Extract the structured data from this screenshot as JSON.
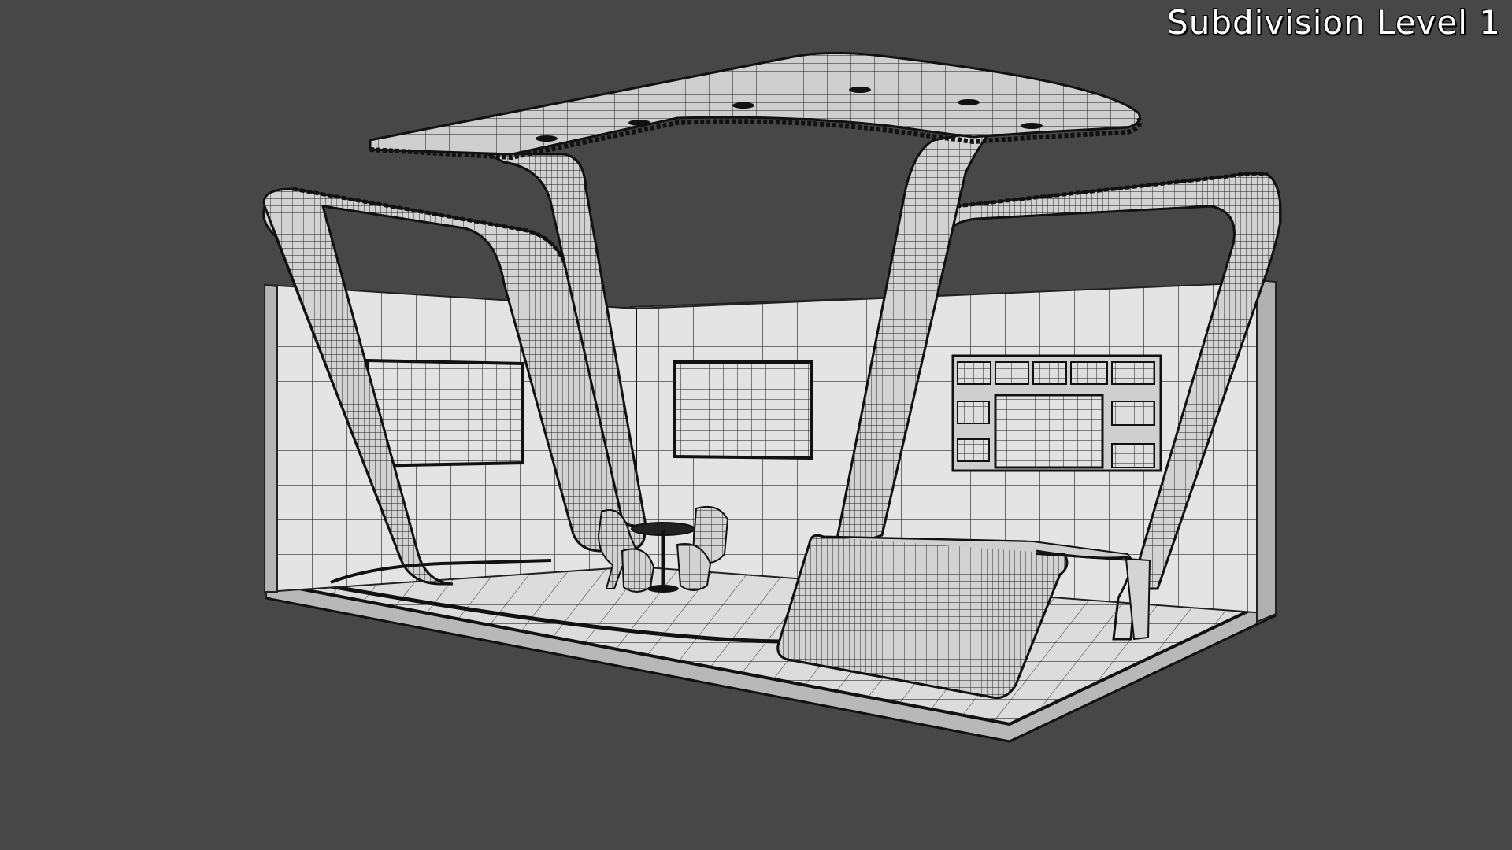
{
  "viewport": {
    "overlay_label": "Subdivision Level 1",
    "background_color": "#474747",
    "mesh_fill_color": "#e6e6e6",
    "wire_color": "#1e1e1e"
  },
  "scene": {
    "subject": "exhibition-booth-model",
    "display_mode": "wireframe-on-shaded"
  }
}
